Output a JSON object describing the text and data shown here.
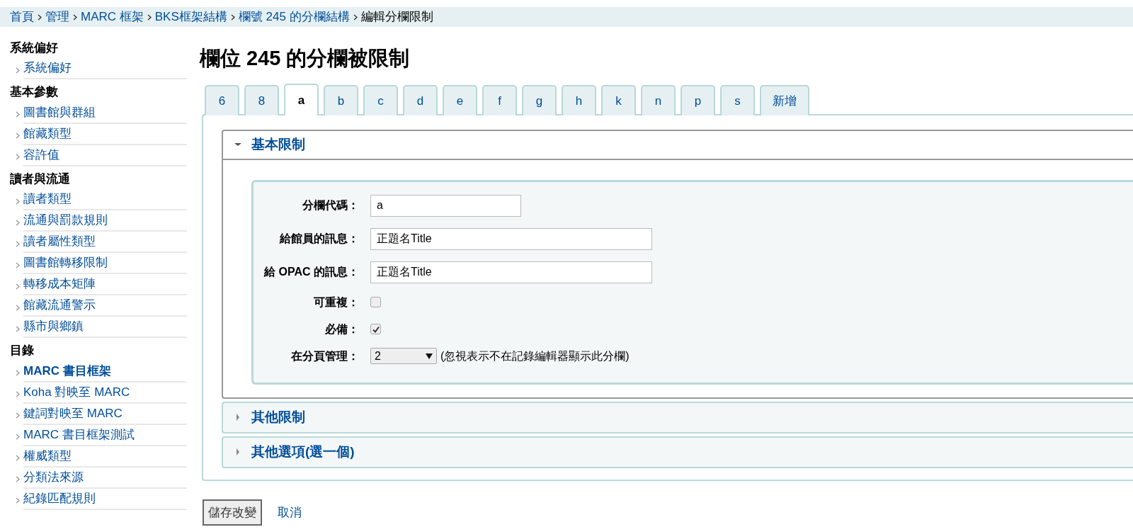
{
  "breadcrumb": [
    {
      "text": "首頁",
      "link": true
    },
    {
      "text": "管理",
      "link": true
    },
    {
      "text": "MARC 框架",
      "link": true
    },
    {
      "text": "BKS框架結構",
      "link": true
    },
    {
      "text": "欄號 245 的分欄結構",
      "link": true
    },
    {
      "text": "編輯分欄限制",
      "link": false
    }
  ],
  "sidebar": [
    {
      "heading": "系統偏好",
      "items": [
        {
          "label": "系統偏好",
          "selected": false
        }
      ]
    },
    {
      "heading": "基本參數",
      "items": [
        {
          "label": "圖書館與群組",
          "selected": false
        },
        {
          "label": "館藏類型",
          "selected": false
        },
        {
          "label": "容許值",
          "selected": false
        }
      ]
    },
    {
      "heading": "讀者與流通",
      "items": [
        {
          "label": "讀者類型",
          "selected": false
        },
        {
          "label": "流通與罰款規則",
          "selected": false
        },
        {
          "label": "讀者屬性類型",
          "selected": false
        },
        {
          "label": "圖書館轉移限制",
          "selected": false
        },
        {
          "label": "轉移成本矩陣",
          "selected": false
        },
        {
          "label": "館藏流通警示",
          "selected": false
        },
        {
          "label": "縣市與鄉鎮",
          "selected": false
        }
      ]
    },
    {
      "heading": "目錄",
      "items": [
        {
          "label": "MARC 書目框架",
          "selected": true
        },
        {
          "label": "Koha 對映至 MARC",
          "selected": false
        },
        {
          "label": "鍵詞對映至 MARC",
          "selected": false
        },
        {
          "label": "MARC 書目框架測試",
          "selected": false
        },
        {
          "label": "權威類型",
          "selected": false
        },
        {
          "label": "分類法來源",
          "selected": false
        },
        {
          "label": "紀錄匹配規則",
          "selected": false
        }
      ]
    }
  ],
  "page_title": "欄位 245 的分欄被限制",
  "tabs": [
    {
      "label": "6",
      "selected": false
    },
    {
      "label": "8",
      "selected": false
    },
    {
      "label": "a",
      "selected": true
    },
    {
      "label": "b",
      "selected": false
    },
    {
      "label": "c",
      "selected": false
    },
    {
      "label": "d",
      "selected": false
    },
    {
      "label": "e",
      "selected": false
    },
    {
      "label": "f",
      "selected": false
    },
    {
      "label": "g",
      "selected": false
    },
    {
      "label": "h",
      "selected": false
    },
    {
      "label": "k",
      "selected": false
    },
    {
      "label": "n",
      "selected": false
    },
    {
      "label": "p",
      "selected": false
    },
    {
      "label": "s",
      "selected": false
    },
    {
      "label": "新增",
      "selected": false
    }
  ],
  "sections": [
    {
      "title": "基本限制",
      "expanded": true,
      "fields": [
        {
          "kind": "text",
          "label": "分欄代碼：",
          "value": "a",
          "wide": false
        },
        {
          "kind": "text",
          "label": "給館員的訊息：",
          "value": "正題名Title",
          "wide": true
        },
        {
          "kind": "text",
          "label": "給 OPAC 的訊息：",
          "value": "正題名Title",
          "wide": true
        },
        {
          "kind": "checkbox",
          "label": "可重複：",
          "checked": false
        },
        {
          "kind": "checkbox",
          "label": "必備：",
          "checked": true
        },
        {
          "kind": "select",
          "label": "在分頁管理：",
          "value": "2",
          "hint": "(忽視表示不在記錄編輯器顯示此分欄)"
        }
      ]
    },
    {
      "title": "其他限制",
      "expanded": false
    },
    {
      "title": "其他選項(選一個)",
      "expanded": false
    }
  ],
  "actions": {
    "save": "儲存改變",
    "cancel": "取消"
  }
}
